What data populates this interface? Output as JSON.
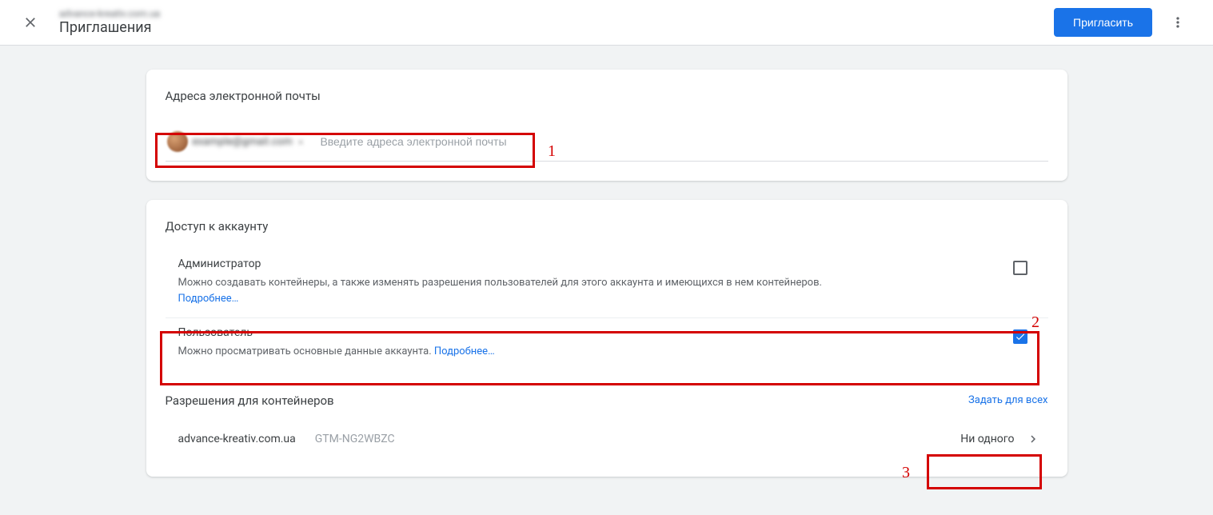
{
  "header": {
    "subtitle_blurred": "advance-kreativ.com.ua",
    "title": "Приглашения",
    "invite_button": "Пригласить"
  },
  "email_card": {
    "title": "Адреса электронной почты",
    "chip_text_blurred": "example@gmail.com",
    "input_placeholder": "Введите адреса электронной почты"
  },
  "access_card": {
    "title": "Доступ к аккаунту",
    "admin": {
      "title": "Администратор",
      "desc": "Можно создавать контейнеры, а также изменять разрешения пользователей для этого аккаунта и имеющихся в нем контейнеров.",
      "more": "Подробнее…",
      "checked": false
    },
    "user": {
      "title": "Пользователь",
      "desc": "Можно просматривать основные данные аккаунта. ",
      "more": "Подробнее…",
      "checked": true
    }
  },
  "permissions": {
    "title": "Разрешения для контейнеров",
    "set_all": "Задать для всех",
    "container_name": "advance-kreativ.com.ua",
    "container_id": "GTM-NG2WBZC",
    "level": "Ни одного"
  },
  "annotations": {
    "n1": "1",
    "n2": "2",
    "n3": "3"
  }
}
